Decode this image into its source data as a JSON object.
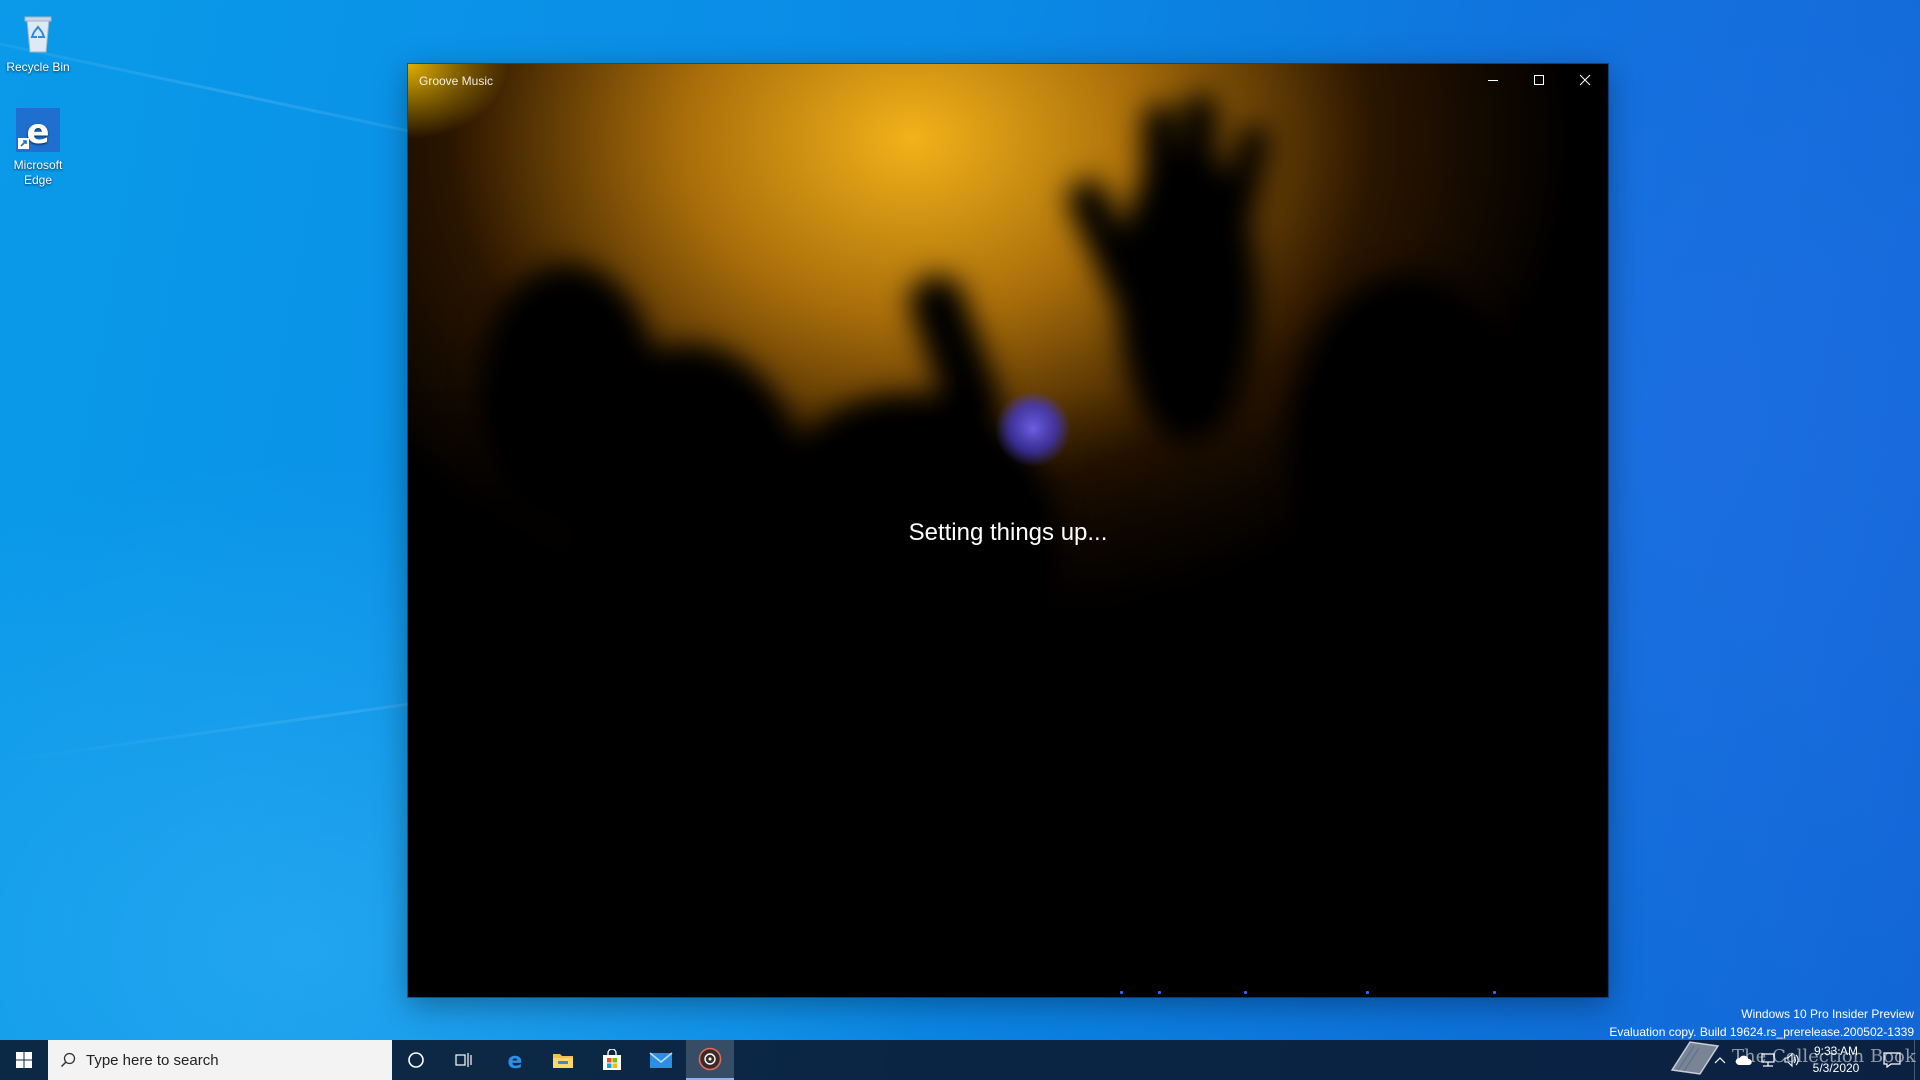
{
  "desktop": {
    "icons": [
      {
        "label": "Recycle Bin",
        "icon": "recycle-bin-icon"
      },
      {
        "label": "Microsoft Edge",
        "icon": "edge-icon"
      }
    ]
  },
  "window": {
    "title": "Groove Music",
    "status": "Setting things up...",
    "controls": [
      "minimize-icon",
      "maximize-icon",
      "close-icon"
    ]
  },
  "watermark": {
    "line1": "Windows 10 Pro Insider Preview",
    "line2": "Evaluation copy. Build 19624.rs_prerelease.200502-1339",
    "brand": "The Collection Book"
  },
  "taskbar": {
    "search_placeholder": "Type here to search",
    "pinned": [
      "cortana-icon",
      "task-view-icon",
      "edge-icon",
      "file-explorer-icon",
      "store-icon",
      "mail-icon",
      "groove-music-icon"
    ],
    "active_app": "groove-music-icon",
    "clock": {
      "time": "9:33 AM",
      "date": "5/3/2020"
    }
  },
  "colors": {
    "desktop_blue": "#0a8be6",
    "taskbar": "#0a182d",
    "window_glow": "#f2b21a",
    "progress_dot": "#2a6cff"
  }
}
